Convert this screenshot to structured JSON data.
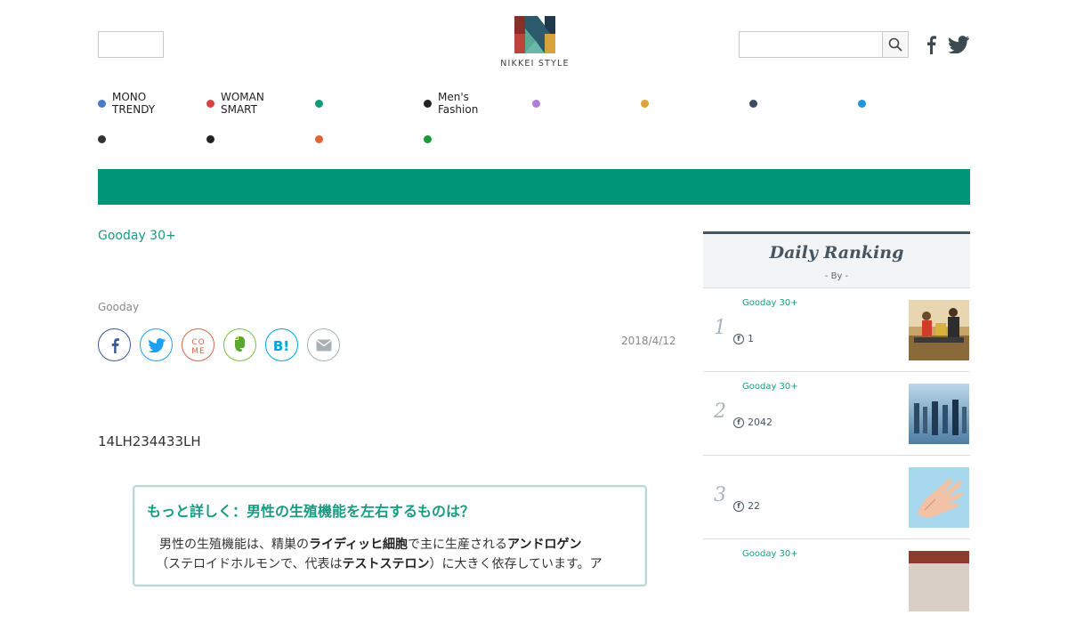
{
  "header": {
    "logo_text": "NIKKEI STYLE",
    "icons": [
      "logo-mark",
      "search-icon",
      "facebook-icon",
      "twitter-icon"
    ]
  },
  "nav": {
    "row1": [
      {
        "label": "MONO\nTRENDY",
        "color": "#4a79c9"
      },
      {
        "label": "WOMAN\nSMART",
        "color": "#d0453f"
      },
      {
        "label": "",
        "color": "#13997b"
      },
      {
        "label": "Men's\nFashion",
        "color": "#222222"
      },
      {
        "label": "",
        "color": "#b27fd6"
      },
      {
        "label": "",
        "color": "#dba53c"
      },
      {
        "label": "",
        "color": "#3b4a68"
      },
      {
        "label": "",
        "color": "#1f95d8"
      }
    ],
    "row2": [
      {
        "label": "",
        "color": "#333333"
      },
      {
        "label": "",
        "color": "#222222"
      },
      {
        "label": "",
        "color": "#e06537"
      },
      {
        "label": "",
        "color": "#1a9a3a"
      }
    ]
  },
  "article": {
    "breadcrumb": "Gooday 30+",
    "author": "Gooday",
    "date": "2018/4/12",
    "code": "14LH234433LH",
    "share": [
      "facebook-icon",
      "twitter-icon",
      "come-icon",
      "evernote-icon",
      "hatena-icon",
      "mail-icon"
    ],
    "figure": {
      "title": "もっと詳しく：男性の生殖機能を左右するものは？",
      "body_line1_a": "男性の生殖機能は、精巣の",
      "body_line1_b": "ライディッヒ細胞",
      "body_line1_c": "で主に生産される",
      "body_line1_d": "アンドロゲン",
      "body_line2_a": "（ステロイドホルモンで、代表は",
      "body_line2_b": "テストステロン",
      "body_line2_c": "）に大きく依存しています。ア"
    }
  },
  "ranking": {
    "title": "Daily Ranking",
    "by": "- By  -",
    "items": [
      {
        "rank": "1",
        "category": "Gooday 30+",
        "fb_count": "1"
      },
      {
        "rank": "2",
        "category": "Gooday 30+",
        "fb_count": "2042"
      },
      {
        "rank": "3",
        "category": "",
        "fb_count": "22"
      },
      {
        "rank": "",
        "category": "Gooday 30+",
        "fb_count": ""
      }
    ]
  },
  "colors": {
    "accent": "#009478",
    "ranking_head": "#46555f"
  }
}
